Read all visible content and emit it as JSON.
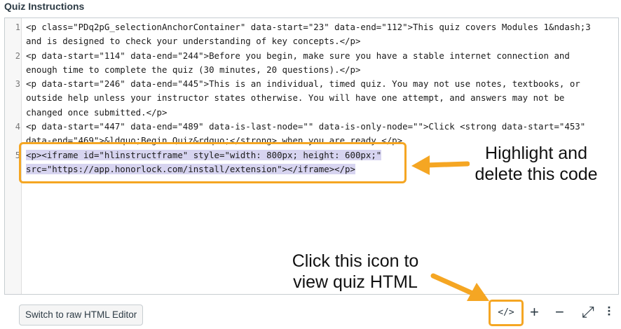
{
  "panel": {
    "title": "Quiz Instructions"
  },
  "editor": {
    "line_numbers": [
      "1",
      "2",
      "3",
      "4",
      "5"
    ],
    "line1a": "<p class=\"PDq2pG_selectionAnchorContainer\" data-start=\"23\" data-end=\"112\">This quiz covers Modules 1&ndash;3",
    "line1b": "and is designed to check your understanding of key concepts.</p>",
    "line2a": "<p data-start=\"114\" data-end=\"244\">Before you begin, make sure you have a stable internet connection and",
    "line2b": "enough time to complete the quiz (30 minutes, 20 questions).</p>",
    "line3a": "<p data-start=\"246\" data-end=\"445\">This is an individual, timed quiz. You may not use notes, textbooks, or",
    "line3b": "outside help unless your instructor states otherwise. You will have one attempt, and answers may not be",
    "line3c": "changed once submitted.</p>",
    "line4a": "<p data-start=\"447\" data-end=\"489\" data-is-last-node=\"\" data-is-only-node=\"\">Click <strong data-start=\"453\"",
    "line4b": "data-end=\"469\">&ldquo;Begin Quiz&rdquo;</strong> when you are ready.</p>",
    "line5a": "<p><iframe id=\"hlinstructframe\" style=\"width: 800px; height: 600px;\"",
    "line5b": "src=\"https://app.honorlock.com/install/extension\"></iframe></p>"
  },
  "annotations": {
    "delete_note": [
      "Highlight and",
      "delete this code"
    ],
    "icon_note": [
      "Click this icon to",
      "view quiz HTML"
    ]
  },
  "toolbar": {
    "raw_html_label": "Switch to raw HTML Editor",
    "html_icon_label": "</>",
    "plus_label": "+",
    "minus_label": "−",
    "expand_label": "⤢",
    "grip_label": "⠇"
  },
  "colors": {
    "accent": "#f5a623",
    "selection": "#d7d4f0"
  }
}
